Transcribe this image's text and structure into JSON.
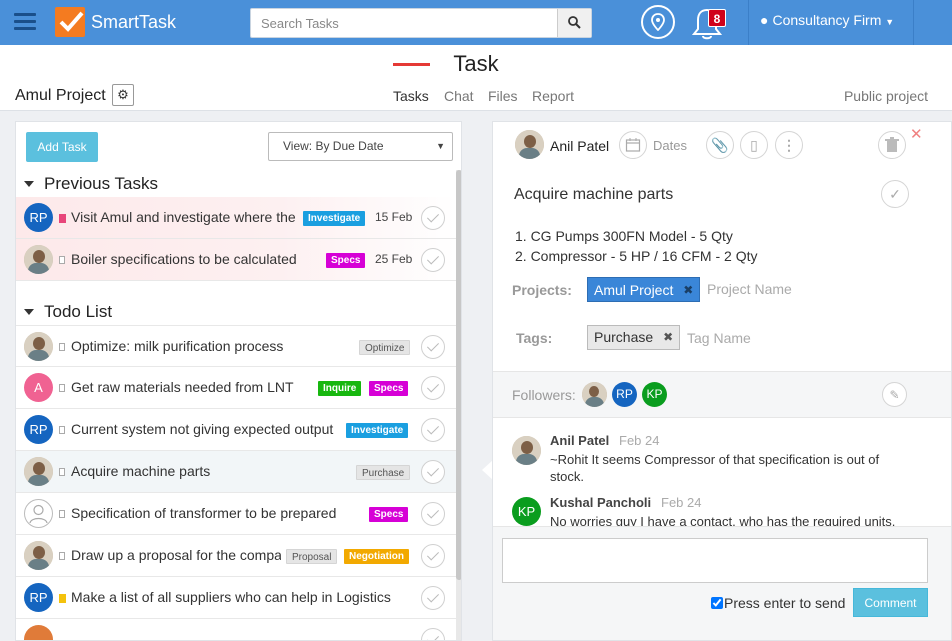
{
  "app": {
    "brand": "SmartTask",
    "search_placeholder": "Search Tasks",
    "notification_count": "8",
    "organization": "Consultancy Firm"
  },
  "header": {
    "title": "Task",
    "project_name": "Amul Project",
    "tabs": [
      {
        "label": "Tasks"
      },
      {
        "label": "Chat"
      },
      {
        "label": "Files"
      },
      {
        "label": "Report"
      }
    ],
    "active_tab": "Tasks",
    "visibility": "Public project"
  },
  "task_list": {
    "add_task_label": "Add Task",
    "view_label": "View: By Due Date",
    "sections": [
      {
        "title": "Previous Tasks",
        "tasks": [
          {
            "assignee": "RP",
            "text": "Visit Amul and investigate where the",
            "tags": [
              "Investigate"
            ],
            "due": "15 Feb"
          },
          {
            "assignee": "photo",
            "text": "Boiler specifications to be calculated",
            "tags": [
              "Specs"
            ],
            "due": "25 Feb"
          }
        ]
      },
      {
        "title": "Todo List",
        "tasks": [
          {
            "assignee": "photo",
            "text": "Optimize: milk purification process",
            "tags": [
              "Optimize"
            ]
          },
          {
            "assignee": "A",
            "text": "Get raw materials needed from LNT",
            "tags": [
              "Inquire",
              "Specs"
            ]
          },
          {
            "assignee": "RP",
            "text": "Current system not giving expected output",
            "tags": [
              "Investigate"
            ]
          },
          {
            "assignee": "photo",
            "text": "Acquire machine parts",
            "tags": [
              "Purchase"
            ]
          },
          {
            "assignee": "none",
            "text": "Specification of transformer to be prepared",
            "tags": [
              "Specs"
            ]
          },
          {
            "assignee": "photo",
            "text": "Draw up a proposal for the compa",
            "tags": [
              "Proposal",
              "Negotiation"
            ]
          },
          {
            "assignee": "RP",
            "text": "Make a list of all suppliers who can help in Logistics",
            "tags": []
          }
        ]
      }
    ]
  },
  "task_detail": {
    "assignee": "Anil Patel",
    "dates_label": "Dates",
    "title": "Acquire machine parts",
    "description": [
      "1. CG Pumps 300FN Model - 5 Qty",
      "2. Compressor - 5 HP / 16 CFM - 2 Qty"
    ],
    "projects_label": "Projects:",
    "project_chip": "Amul Project",
    "project_placeholder": "Project Name",
    "tags_label": "Tags:",
    "tag_chip": "Purchase",
    "tag_placeholder": "Tag Name",
    "followers_label": "Followers:",
    "followers": [
      "photo",
      "RP",
      "KP"
    ],
    "comments": [
      {
        "author": "Anil Patel",
        "date": "Feb 24",
        "lines": [
          "~Rohit It seems Compressor of that specification is out of",
          "stock."
        ]
      },
      {
        "author": "Kushal Pancholi",
        "initials": "KP",
        "date": "Feb 24",
        "lines": [
          "No worries guy I have a contact, who has the required units."
        ]
      }
    ],
    "press_enter_label": "Press enter to send",
    "comment_button": "Comment"
  },
  "colors": {
    "topbar": "#4a90d9",
    "accent": "#5bc0de",
    "tab_underline": "#e53935",
    "tag_cyan": "#1a9fe0",
    "tag_magenta": "#d600d6",
    "tag_green": "#17b70f",
    "tag_orange": "#f2a900"
  }
}
